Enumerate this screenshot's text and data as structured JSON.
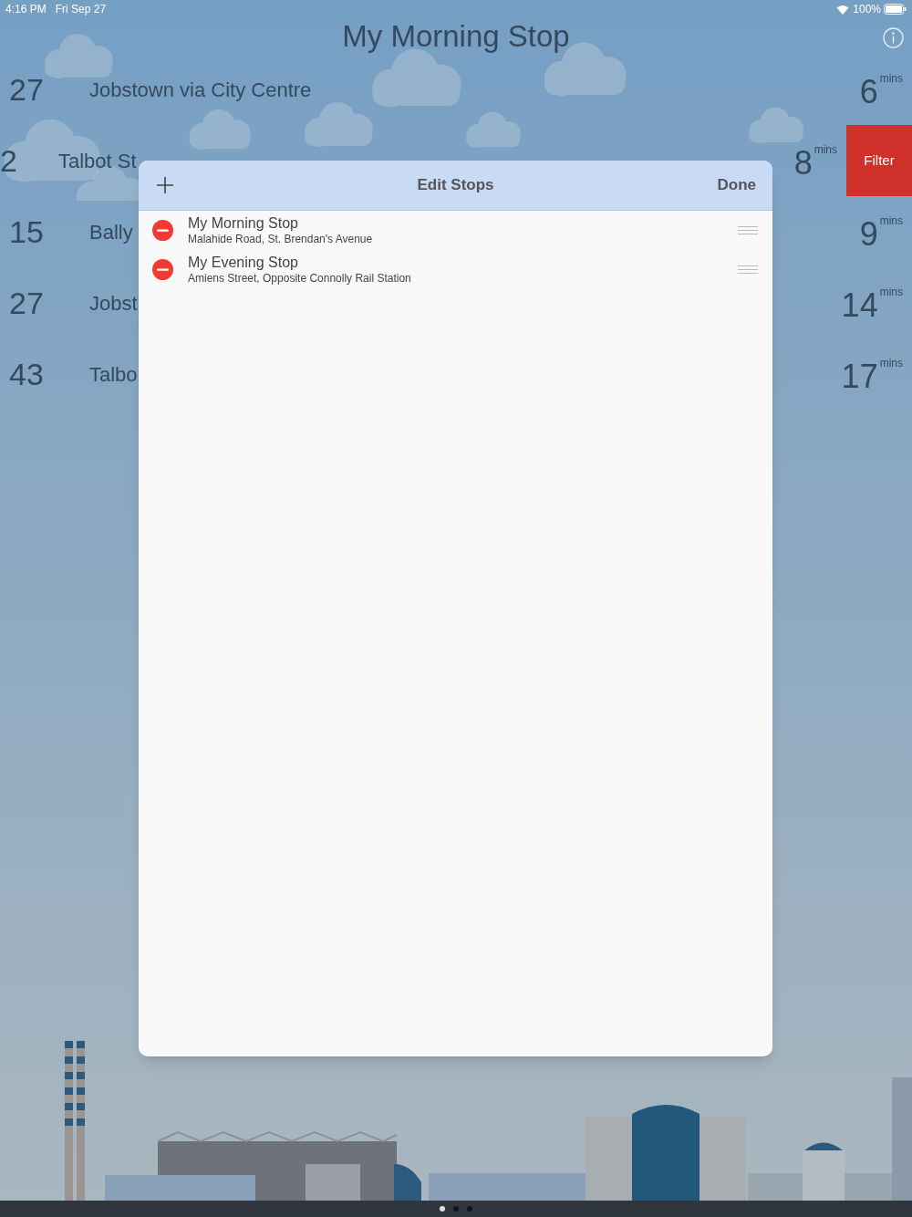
{
  "status_bar": {
    "time": "4:16 PM",
    "date": "Fri Sep 27",
    "battery": "100%"
  },
  "title": "My Morning Stop",
  "departures": [
    {
      "route": "27",
      "destination": "Jobstown via City Centre",
      "due": "6",
      "unit": "mins"
    },
    {
      "route": "2",
      "destination": "Talbot St",
      "due": "8",
      "unit": "mins",
      "action": "Filter"
    },
    {
      "route": "15",
      "destination": "Bally",
      "due": "9",
      "unit": "mins"
    },
    {
      "route": "27",
      "destination": "Jobst",
      "due": "14",
      "unit": "mins"
    },
    {
      "route": "43",
      "destination": "Talbo",
      "due": "17",
      "unit": "mins"
    }
  ],
  "sheet": {
    "title": "Edit Stops",
    "done": "Done",
    "stops": [
      {
        "name": "My Morning Stop",
        "address": "Malahide Road, St. Brendan's Avenue"
      },
      {
        "name": "My Evening Stop",
        "address": "Amiens Street, Opposite Connolly Rail Station"
      }
    ]
  },
  "pages": [
    {
      "selected": true
    },
    {
      "selected": false
    },
    {
      "selected": false
    }
  ]
}
